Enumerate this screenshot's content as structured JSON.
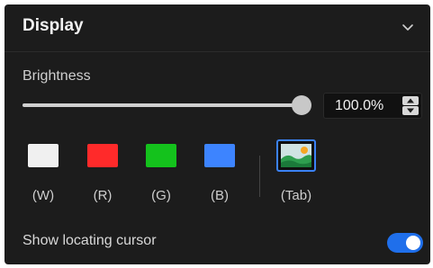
{
  "panel": {
    "title": "Display"
  },
  "brightness": {
    "label": "Brightness",
    "value": 100.0,
    "display_value": "100.0%",
    "max": 100.0
  },
  "swatches": [
    {
      "label": "(W)",
      "color": "#f0f0f0"
    },
    {
      "label": "(R)",
      "color": "#ff2a2a"
    },
    {
      "label": "(G)",
      "color": "#14c21c"
    },
    {
      "label": "(B)",
      "color": "#3d84ff"
    }
  ],
  "tab_option": {
    "label": "(Tab)",
    "icon": "image-icon"
  },
  "locating_cursor": {
    "label": "Show locating cursor",
    "enabled": true
  },
  "colors": {
    "panel_bg": "#1c1c1c",
    "accent": "#1f6feb",
    "selected_outline": "#3b82f6"
  }
}
